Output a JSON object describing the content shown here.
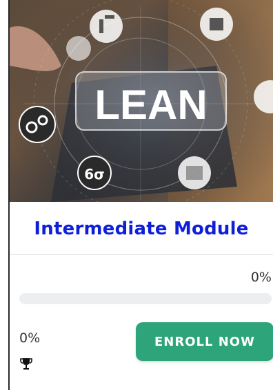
{
  "course": {
    "hero_text": "LEAN",
    "sigma_text": "6σ",
    "title": "Intermediate Module"
  },
  "progress": {
    "percent_label_top": "0%",
    "percent_value": 0,
    "percent_label_bottom": "0%"
  },
  "actions": {
    "enroll_label": "ENROLL NOW"
  },
  "icons": {
    "trophy": "trophy-icon"
  },
  "colors": {
    "title": "#0f1fd8",
    "button": "#2da47a",
    "progress_track": "#eceef0"
  }
}
